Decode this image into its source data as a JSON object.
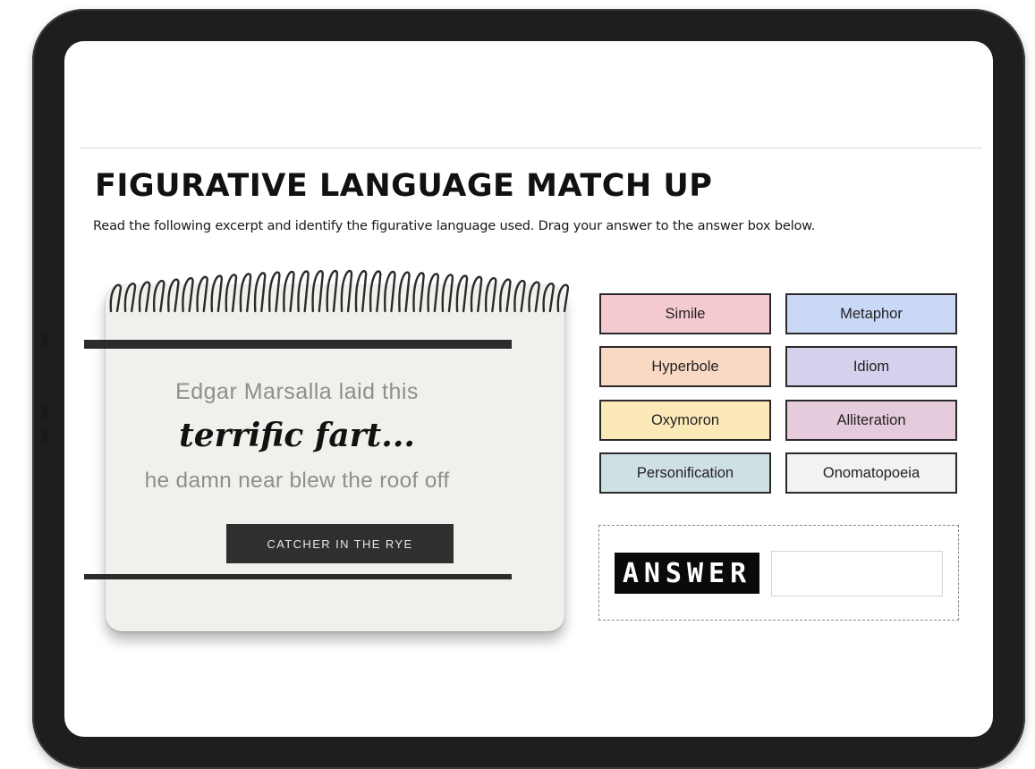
{
  "page": {
    "title": "FIGURATIVE LANGUAGE MATCH UP",
    "instructions": "Read the following excerpt and identify the figurative language used. Drag your answer to the answer box below."
  },
  "excerpt": {
    "line1": "Edgar Marsalla laid this",
    "emphasis": "terrific fart...",
    "line2": "he damn near blew the roof off",
    "source_button": "CATCHER IN THE RYE"
  },
  "choices": [
    {
      "label": "Simile",
      "color": "#f4c9cf"
    },
    {
      "label": "Metaphor",
      "color": "#c9d8f6"
    },
    {
      "label": "Hyperbole",
      "color": "#f9d8c4"
    },
    {
      "label": "Idiom",
      "color": "#d6d0ec"
    },
    {
      "label": "Oxymoron",
      "color": "#fbeab8"
    },
    {
      "label": "Alliteration",
      "color": "#e6cbdc"
    },
    {
      "label": "Personification",
      "color": "#cfe0e4"
    },
    {
      "label": "Onomatopoeia",
      "color": "#f2f2f2"
    }
  ],
  "answer": {
    "label": "ANSWER",
    "value": ""
  },
  "icons": {
    "spiral": "spiral-binding-icon"
  }
}
